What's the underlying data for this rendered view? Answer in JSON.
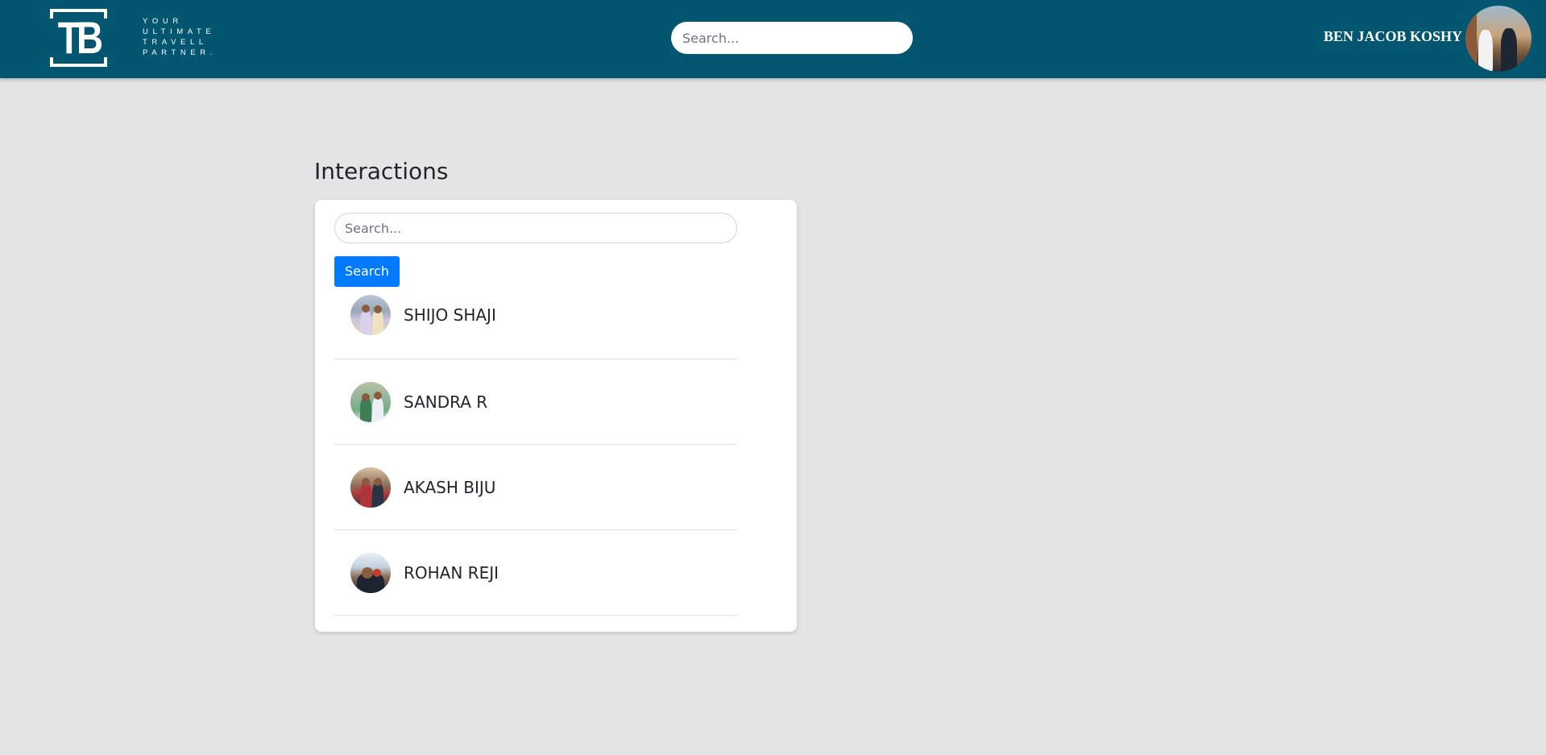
{
  "header": {
    "logo_letters": "TB",
    "tagline": [
      "YOUR",
      "ULTIMATE",
      "TRAVELL",
      "PARTNER."
    ],
    "search_placeholder": "Search...",
    "user_name": "BEN JACOB KOSHY",
    "background_color": "#03566f"
  },
  "main": {
    "title": "Interactions",
    "search_placeholder": "Search...",
    "search_button_label": "Search",
    "button_color": "#007bff",
    "users": [
      {
        "name": "SHIJO SHAJI"
      },
      {
        "name": "SANDRA R"
      },
      {
        "name": "AKASH BIJU"
      },
      {
        "name": "ROHAN REJI"
      }
    ]
  }
}
